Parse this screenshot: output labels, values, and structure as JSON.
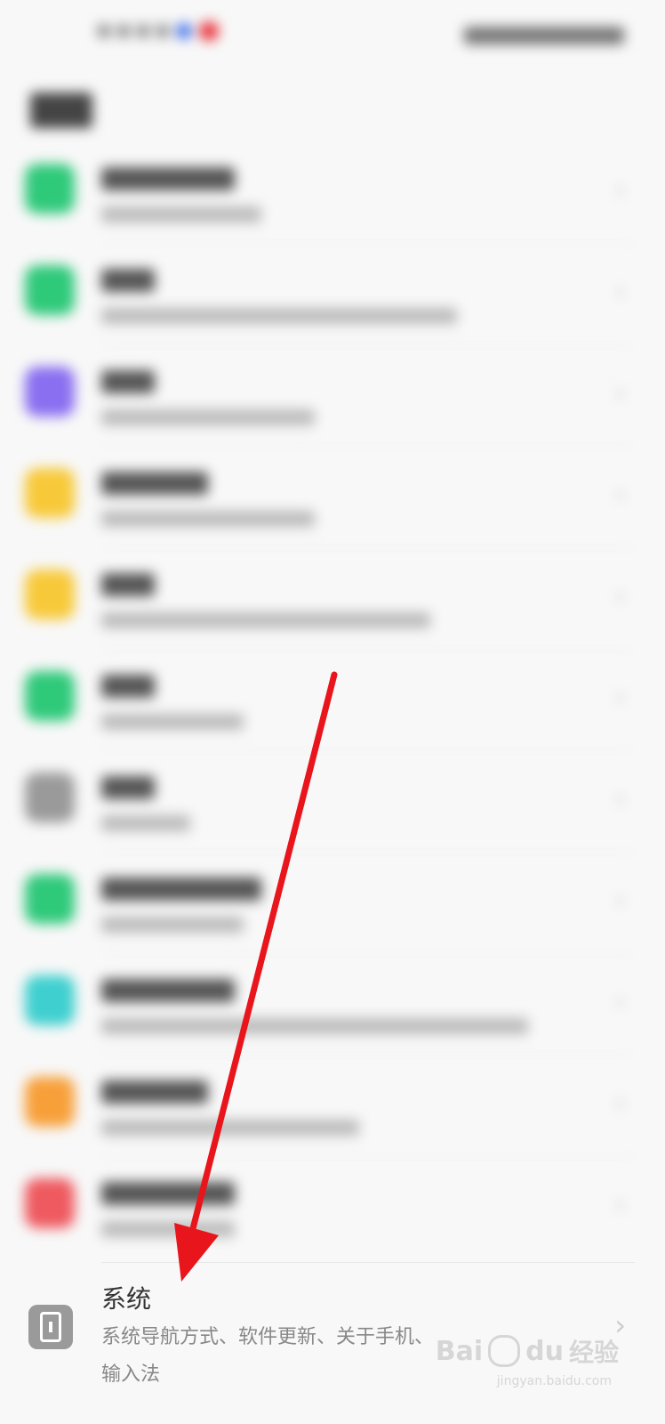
{
  "system_item": {
    "title": "系统",
    "subtitle_line1": "系统导航方式、软件更新、关于手机、",
    "subtitle_line2": "输入法",
    "icon": "phone-icon"
  },
  "watermark": {
    "brand": "Bai",
    "brand2": "du",
    "suffix": "经验",
    "url": "jingyan.baidu.com"
  },
  "colors": {
    "arrow": "#e8161c",
    "icon_green": "#2fc97a",
    "icon_purple": "#8a6ff0",
    "icon_yellow": "#f7c93a",
    "icon_teal": "#3fcfcf",
    "icon_orange": "#f7a03a",
    "icon_red": "#ee5a60",
    "icon_gray": "#9a9a9a"
  }
}
